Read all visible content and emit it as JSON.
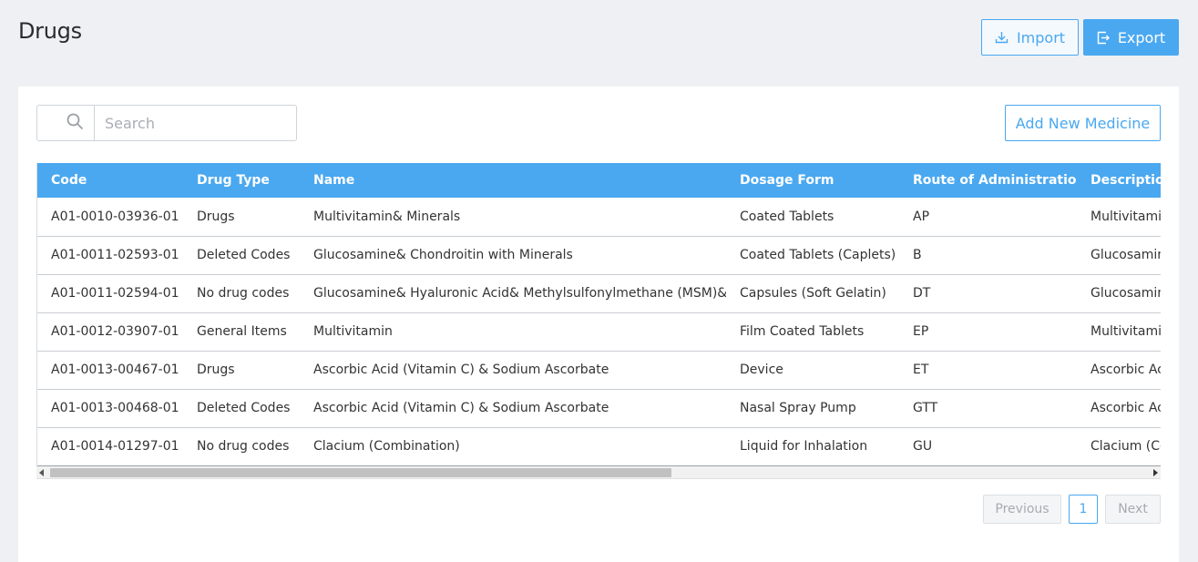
{
  "header": {
    "title": "Drugs",
    "import_label": "Import",
    "export_label": "Export"
  },
  "toolbar": {
    "search_placeholder": "Search",
    "search_value": "",
    "add_label": "Add New Medicine"
  },
  "table": {
    "columns": [
      "Code",
      "Drug Type",
      "Name",
      "Dosage Form",
      "Route of Administration",
      "Description"
    ],
    "rows": [
      [
        "A01-0010-03936-01",
        "Drugs",
        "Multivitamin& Minerals",
        "Coated Tablets",
        "AP",
        "Multivitamin"
      ],
      [
        "A01-0011-02593-01",
        "Deleted Codes",
        "Glucosamine& Chondroitin with Minerals",
        "Coated Tablets (Caplets)",
        "B",
        "Glucosamine"
      ],
      [
        "A01-0011-02594-01",
        "No drug codes",
        "Glucosamine& Hyaluronic Acid& Methylsulfonylmethane (MSM)& V",
        "Capsules (Soft Gelatin)",
        "DT",
        "Glucosamine"
      ],
      [
        "A01-0012-03907-01",
        "General Items",
        "Multivitamin",
        "Film Coated Tablets",
        "EP",
        "Multivitamin"
      ],
      [
        "A01-0013-00467-01",
        "Drugs",
        "Ascorbic Acid (Vitamin C) & Sodium Ascorbate",
        "Device",
        "ET",
        "Ascorbic Aci"
      ],
      [
        "A01-0013-00468-01",
        "Deleted Codes",
        "Ascorbic Acid (Vitamin C) & Sodium Ascorbate",
        "Nasal Spray Pump",
        "GTT",
        "Ascorbic Aci"
      ],
      [
        "A01-0014-01297-01",
        "No drug codes",
        "Clacium (Combination)",
        "Liquid for Inhalation",
        "GU",
        "Clacium (Co"
      ]
    ]
  },
  "pagination": {
    "previous_label": "Previous",
    "current_page": "1",
    "next_label": "Next"
  },
  "colors": {
    "accent": "#4aa8f0",
    "background": "#eef0f4"
  },
  "icons": {
    "import": "download-icon",
    "export": "export-icon",
    "search": "search-icon"
  }
}
